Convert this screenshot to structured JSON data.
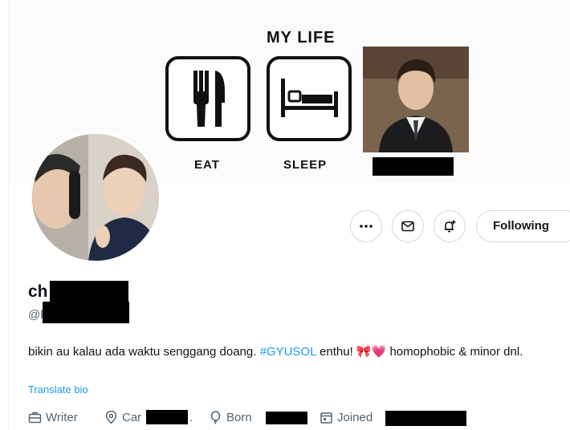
{
  "banner": {
    "title": "MY LIFE",
    "eat_label": "EAT",
    "sleep_label": "SLEEP"
  },
  "profile": {
    "display_name": "ch",
    "handle": "@b",
    "bio_before": "bikin au kalau ada waktu senggang doang. ",
    "hashtag": "#GYUSOL",
    "bio_mid": " enthu! ",
    "bio_emoji": "🎀💗",
    "bio_after": " homophobic & minor dnl.",
    "translate_label": "Translate bio",
    "meta": {
      "profession": "Writer",
      "location": "Car",
      "location_suffix": ".",
      "born": "Born",
      "joined": "Joined"
    }
  },
  "actions": {
    "following_label": "Following"
  },
  "colors": {
    "link": "#1d9bf0",
    "secondary_text": "#536471",
    "border": "#cfd9de"
  }
}
